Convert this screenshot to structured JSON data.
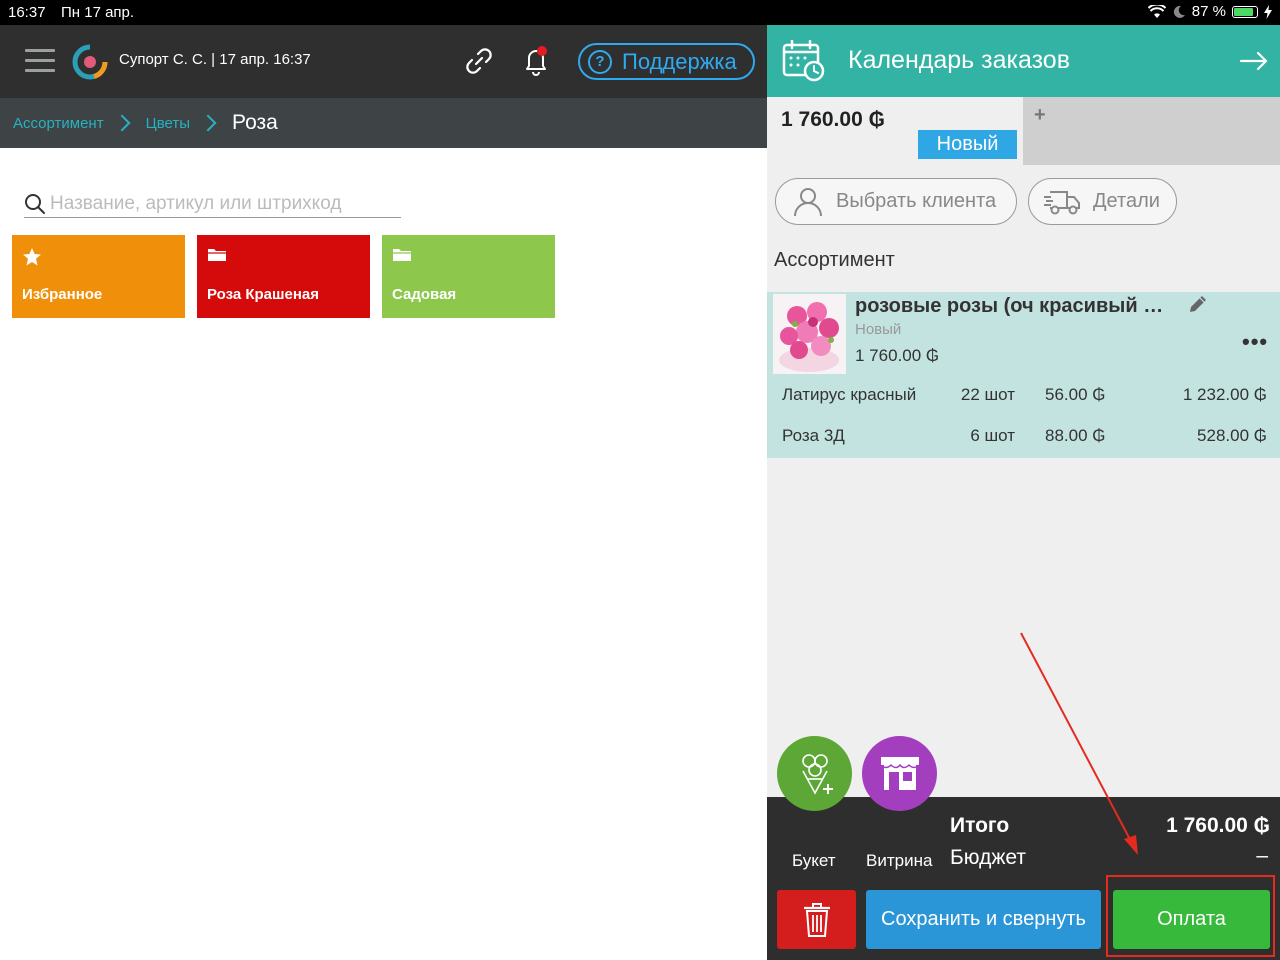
{
  "statusbar": {
    "time": "16:37",
    "date": "Пн 17 апр.",
    "battery": "87 %"
  },
  "topbar": {
    "user_info": "Супорт С. С. | 17 апр. 16:37",
    "support_label": "Поддержка"
  },
  "breadcrumb": {
    "items": [
      "Ассортимент",
      "Цветы"
    ],
    "current": "Роза"
  },
  "search": {
    "placeholder": "Название, артикул или штрихкод",
    "value": ""
  },
  "categories": [
    {
      "label": "Избранное",
      "color": "#f0900a",
      "icon": "star-icon"
    },
    {
      "label": "Роза Крашеная",
      "color": "#d50b0b",
      "icon": "folder-icon"
    },
    {
      "label": "Садовая",
      "color": "#8dc84d",
      "icon": "folder-icon"
    }
  ],
  "order_panel": {
    "title": "Календарь заказов",
    "order_tab": {
      "total": "1 760.00 ₲",
      "status": "Новый"
    },
    "add_tab_label": "+",
    "client_button": "Выбрать клиента",
    "details_button": "Детали",
    "section_label": "Ассортимент",
    "item": {
      "title": "розовые розы (оч красивый бу...",
      "status": "Новый",
      "price": "1 760.00 ₲",
      "components": [
        {
          "name": "Латирус красный",
          "qty": "22 шот",
          "price": "56.00 ₲",
          "sum": "1 232.00 ₲"
        },
        {
          "name": "Роза 3Д",
          "qty": "6 шот",
          "price": "88.00 ₲",
          "sum": "528.00 ₲"
        }
      ]
    },
    "bouquet_label": "Букет",
    "showcase_label": "Витрина",
    "total_label": "Итого",
    "total_value": "1 760.00 ₲",
    "budget_label": "Бюджет",
    "budget_value": "–",
    "save_button": "Сохранить и свернуть",
    "pay_button": "Оплата"
  },
  "colors": {
    "accent": "#33b3a3",
    "breadcrumb": "#27b2c2",
    "support": "#2eaaf0",
    "pay": "#37b93c",
    "save": "#2a95d7",
    "delete": "#d41d1d"
  }
}
